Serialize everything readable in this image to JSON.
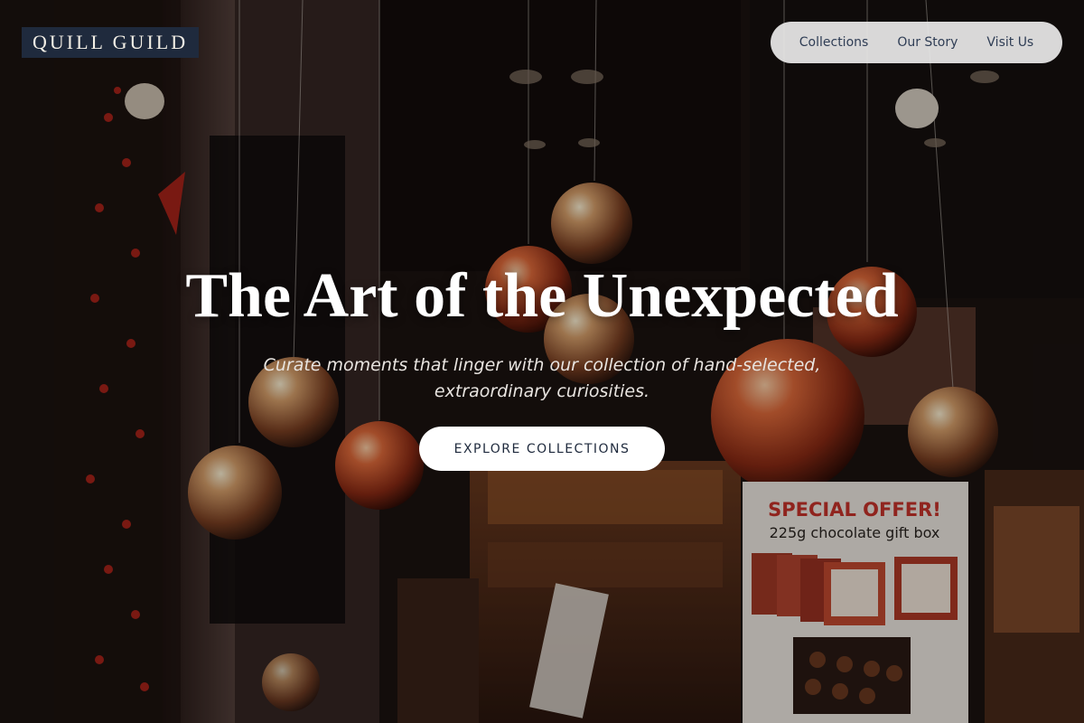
{
  "brand": {
    "name": "QUILL GUILD"
  },
  "nav": {
    "items": [
      {
        "label": "Collections"
      },
      {
        "label": "Our Story"
      },
      {
        "label": "Visit Us"
      }
    ]
  },
  "hero": {
    "title": "The Art of the Unexpected",
    "subtitle_line1": "Curate moments that linger with our collection of hand-selected,",
    "subtitle_line2": "extraordinary curiosities.",
    "cta_label": "EXPLORE COLLECTIONS"
  },
  "sign": {
    "headline": "SPECIAL OFFER!",
    "detail": "225g chocolate gift box"
  },
  "colors": {
    "brand_bg": "#1f2a3d",
    "nav_text": "#2f3d55",
    "ornament_copper": "#c2492a",
    "sign_red": "#c8322a"
  }
}
